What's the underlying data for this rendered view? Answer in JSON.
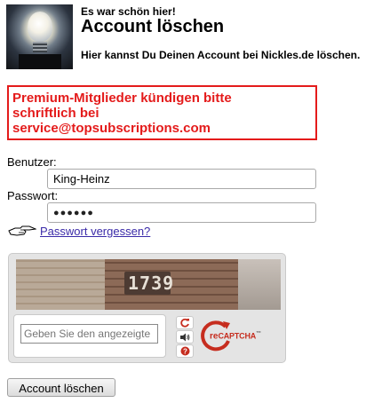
{
  "header": {
    "eyebrow": "Es war schön hier!",
    "title": "Account löschen",
    "subtitle": "Hier kannst Du Deinen Account bei Nickles.de löschen."
  },
  "notice": {
    "line1": "Premium-Mitglieder kündigen bitte",
    "line2": "schriftlich bei",
    "line3": "service@topsubscriptions.com"
  },
  "form": {
    "username_label": "Benutzer:",
    "username_value": "King-Heinz",
    "password_label": "Passwort:",
    "password_mask": "●●●●●●",
    "forgot_link": "Passwort vergessen?",
    "submit_label": "Account löschen"
  },
  "captcha": {
    "image_text": "1739",
    "input_placeholder": "Geben Sie den angezeigte",
    "brand_prefix": "re",
    "brand_name": "CAPTCHA",
    "brand_mark": "™",
    "icons": [
      "reload-icon",
      "audio-icon",
      "help-icon"
    ]
  },
  "colors": {
    "notice_red": "#e41b1b",
    "link_blue": "#3a2aa8",
    "recaptcha_red": "#c62d1f"
  }
}
